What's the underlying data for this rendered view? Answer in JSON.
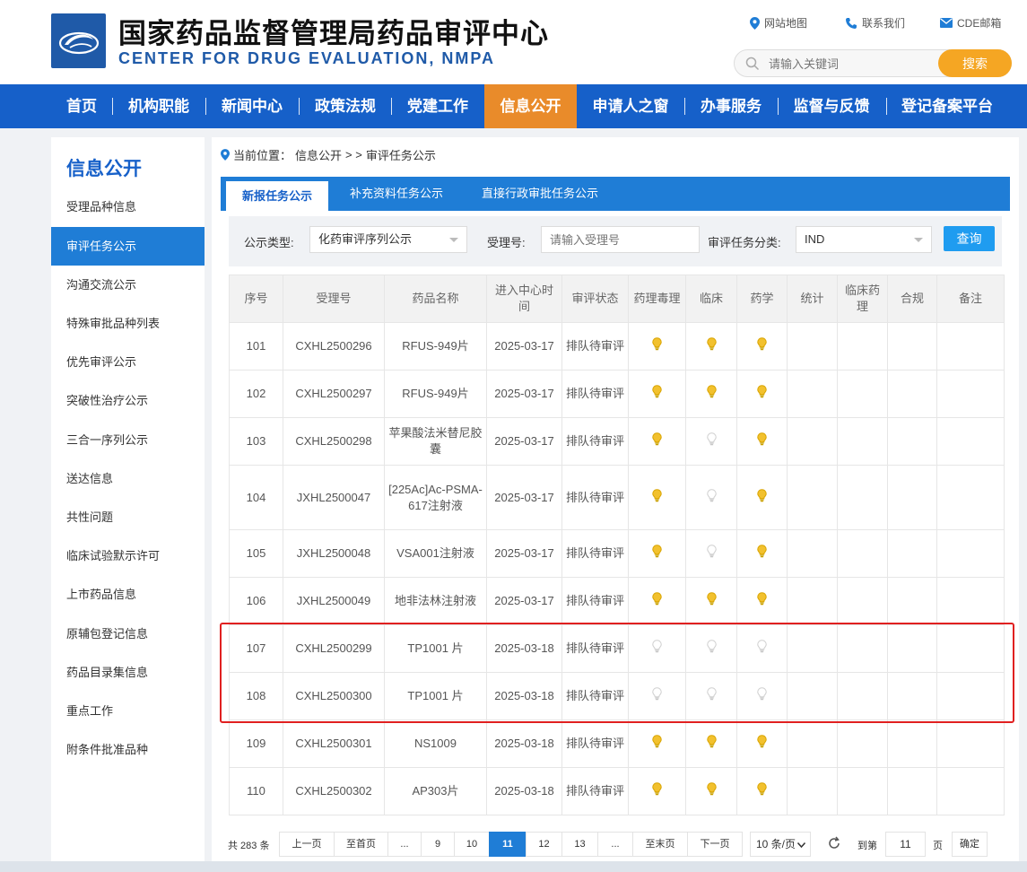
{
  "header": {
    "title_cn": "国家药品监督管理局药品审评中心",
    "title_en": "CENTER FOR DRUG EVALUATION, NMPA",
    "links": [
      {
        "label": "网站地图",
        "icon": "location-pin-icon"
      },
      {
        "label": "联系我们",
        "icon": "phone-icon"
      },
      {
        "label": "CDE邮箱",
        "icon": "mail-icon"
      }
    ],
    "search": {
      "placeholder": "请输入关键词",
      "button": "搜索"
    }
  },
  "nav": {
    "items": [
      "首页",
      "机构职能",
      "新闻中心",
      "政策法规",
      "党建工作",
      "信息公开",
      "申请人之窗",
      "办事服务",
      "监督与反馈",
      "登记备案平台"
    ],
    "active": "信息公开"
  },
  "sidebar": {
    "title": "信息公开",
    "items": [
      "受理品种信息",
      "审评任务公示",
      "沟通交流公示",
      "特殊审批品种列表",
      "优先审评公示",
      "突破性治疗公示",
      "三合一序列公示",
      "送达信息",
      "共性问题",
      "临床试验默示许可",
      "上市药品信息",
      "原辅包登记信息",
      "药品目录集信息",
      "重点工作",
      "附条件批准品种"
    ],
    "active": "审评任务公示"
  },
  "breadcrumb": {
    "prefix": "当前位置：",
    "path": "信息公开",
    "sep": "> >",
    "current": "审评任务公示"
  },
  "tabs": [
    "新报任务公示",
    "补充资料任务公示",
    "直接行政审批任务公示"
  ],
  "filters": {
    "type_label": "公示类型:",
    "type_value": "化药审评序列公示",
    "acceptance_label": "受理号:",
    "acceptance_placeholder": "请输入受理号",
    "category_label": "审评任务分类:",
    "category_value": "IND",
    "query_button": "查询"
  },
  "table": {
    "headers": [
      "序号",
      "受理号",
      "药品名称",
      "进入中心时间",
      "审评状态",
      "药理毒理",
      "临床",
      "药学",
      "统计",
      "临床药理",
      "合规",
      "备注"
    ],
    "rows": [
      {
        "no": "101",
        "id": "CXHL2500296",
        "name": "RFUS-949片",
        "date": "2025-03-17",
        "status": "排队待审评",
        "pharm_tox": "yellow",
        "clinical": "yellow",
        "cmc": "yellow"
      },
      {
        "no": "102",
        "id": "CXHL2500297",
        "name": "RFUS-949片",
        "date": "2025-03-17",
        "status": "排队待审评",
        "pharm_tox": "yellow",
        "clinical": "yellow",
        "cmc": "yellow"
      },
      {
        "no": "103",
        "id": "CXHL2500298",
        "name": "苹果酸法米替尼胶囊",
        "date": "2025-03-17",
        "status": "排队待审评",
        "pharm_tox": "yellow",
        "clinical": "gray",
        "cmc": "yellow"
      },
      {
        "no": "104",
        "id": "JXHL2500047",
        "name": "[225Ac]Ac-PSMA-617注射液",
        "date": "2025-03-17",
        "status": "排队待审评",
        "pharm_tox": "yellow",
        "clinical": "gray",
        "cmc": "yellow"
      },
      {
        "no": "105",
        "id": "JXHL2500048",
        "name": "VSA001注射液",
        "date": "2025-03-17",
        "status": "排队待审评",
        "pharm_tox": "yellow",
        "clinical": "gray",
        "cmc": "yellow"
      },
      {
        "no": "106",
        "id": "JXHL2500049",
        "name": "地非法林注射液",
        "date": "2025-03-17",
        "status": "排队待审评",
        "pharm_tox": "yellow",
        "clinical": "yellow",
        "cmc": "yellow"
      },
      {
        "no": "107",
        "id": "CXHL2500299",
        "name": "TP1001 片",
        "date": "2025-03-18",
        "status": "排队待审评",
        "pharm_tox": "gray",
        "clinical": "gray",
        "cmc": "gray"
      },
      {
        "no": "108",
        "id": "CXHL2500300",
        "name": "TP1001 片",
        "date": "2025-03-18",
        "status": "排队待审评",
        "pharm_tox": "gray",
        "clinical": "gray",
        "cmc": "gray"
      },
      {
        "no": "109",
        "id": "CXHL2500301",
        "name": "NS1009",
        "date": "2025-03-18",
        "status": "排队待审评",
        "pharm_tox": "yellow",
        "clinical": "yellow",
        "cmc": "yellow"
      },
      {
        "no": "110",
        "id": "CXHL2500302",
        "name": "AP303片",
        "date": "2025-03-18",
        "status": "排队待审评",
        "pharm_tox": "yellow",
        "clinical": "yellow",
        "cmc": "yellow"
      }
    ]
  },
  "pager": {
    "total": "共 283 条",
    "prev": "上一页",
    "first": "至首页",
    "ellipsis": "...",
    "pages": [
      "9",
      "10",
      "11",
      "12",
      "13"
    ],
    "current": "11",
    "last": "至末页",
    "next": "下一页",
    "page_size": "10 条/页",
    "goto_prefix": "到第",
    "goto_value": "11",
    "goto_suffix": "页",
    "confirm": "确定"
  },
  "colors": {
    "brand_blue": "#1660c9",
    "tab_blue": "#1f7dd6",
    "active_orange": "#e98b2a",
    "search_orange": "#f5a623",
    "highlight_red": "#e02020",
    "bulb_on": "#f2c12e",
    "bulb_off": "#cfcfcf"
  }
}
